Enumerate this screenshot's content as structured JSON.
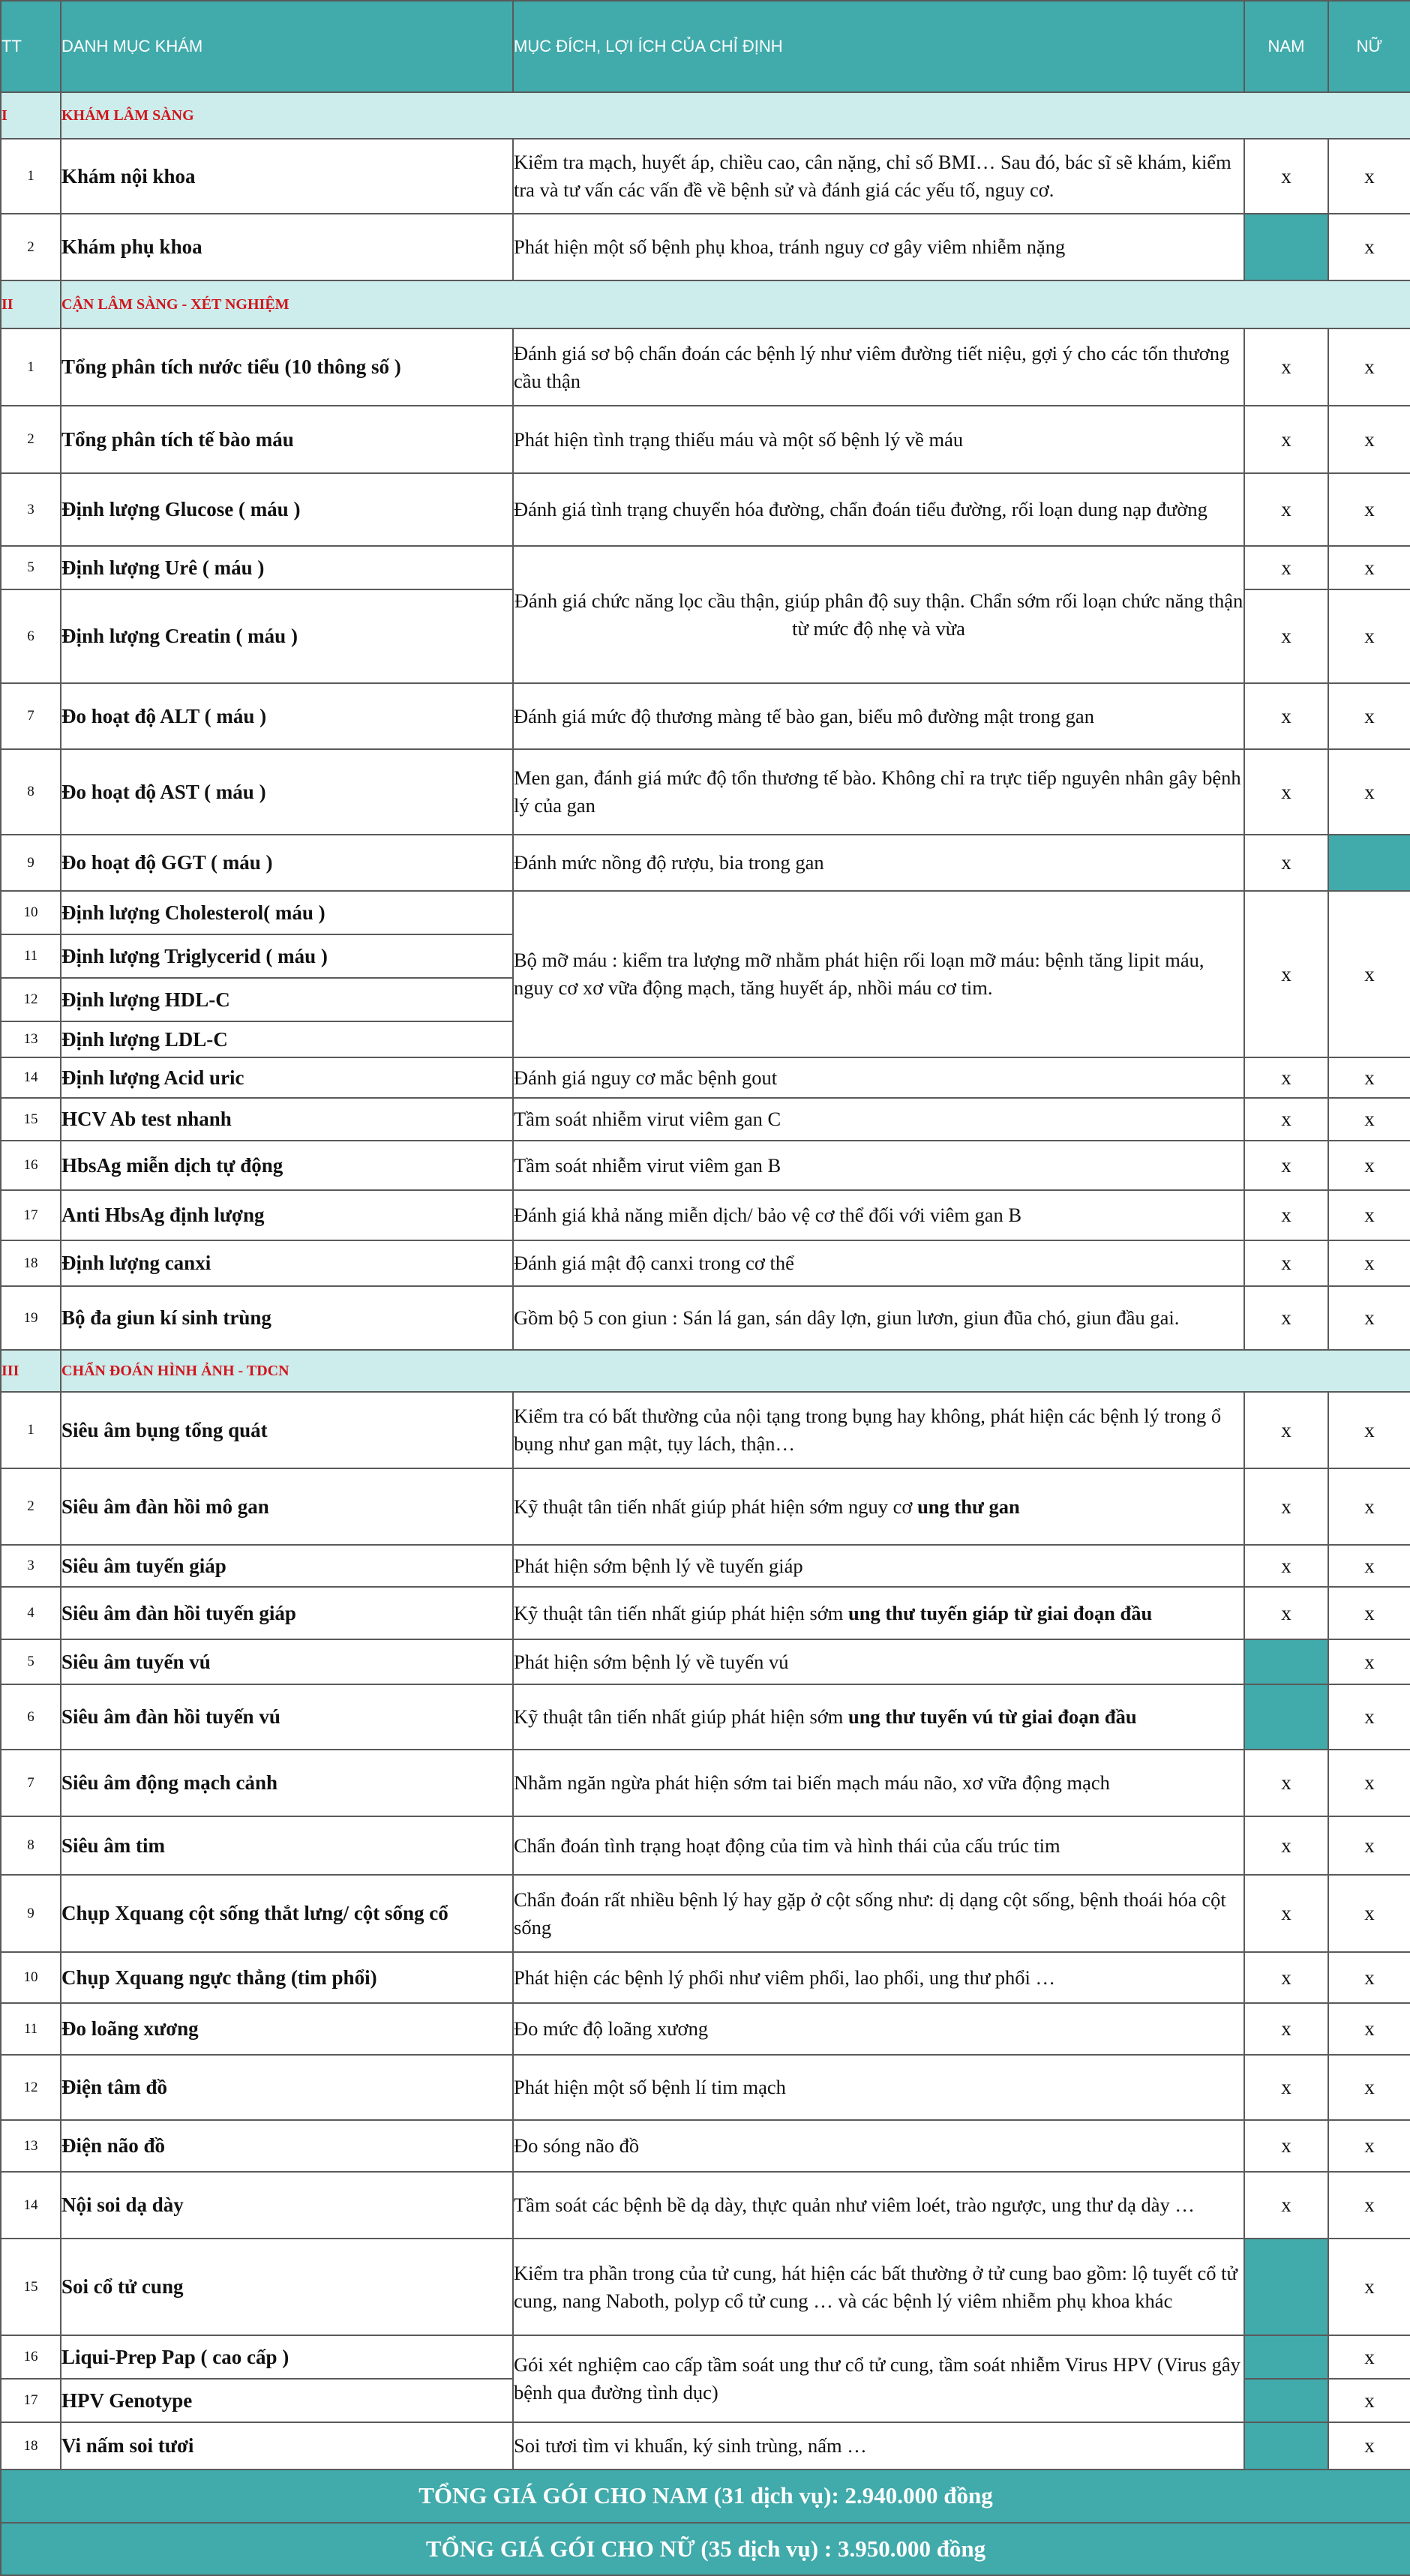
{
  "header": {
    "tt": "TT",
    "item": "DANH MỤC KHÁM",
    "purpose": "MỤC ĐÍCH, LỢI ÍCH CỦA CHỈ ĐỊNH",
    "male": "NAM",
    "female": "NỮ"
  },
  "colors": {
    "accent": "#41aaab",
    "section_bg": "#cdecec",
    "section_text": "#d0161c"
  },
  "sections": [
    {
      "roman": "I",
      "title": "KHÁM LÂM SÀNG",
      "rows": [
        {
          "no": "1",
          "name": "Khám nội khoa",
          "desc": "Kiểm tra mạch, huyết áp, chiều cao, cân nặng, chỉ số BMI… Sau đó, bác sĩ sẽ khám, kiểm tra và tư vấn các vấn đề về bệnh sử và đánh giá các yếu tố, nguy cơ.",
          "male": "x",
          "female": "x"
        },
        {
          "no": "2",
          "name": "Khám phụ khoa",
          "desc": "Phát hiện một số bệnh phụ khoa, tránh nguy cơ gây viêm nhiễm nặng",
          "male": null,
          "female": "x"
        }
      ]
    },
    {
      "roman": "II",
      "title": "CẬN LÂM SÀNG - XÉT NGHIỆM",
      "rows": [
        {
          "no": "1",
          "name": "Tổng phân tích nước tiểu (10 thông số )",
          "desc": "Đánh giá sơ bộ chẩn đoán các bệnh lý như viêm đường tiết niệu, gợi ý cho các tổn thương cầu thận",
          "male": "x",
          "female": "x"
        },
        {
          "no": "2",
          "name": "Tổng phân tích tế bào máu",
          "desc": "Phát hiện tình trạng thiếu máu và một số bệnh lý về máu",
          "male": "x",
          "female": "x"
        },
        {
          "no": "3",
          "name": "Định lượng Glucose ( máu )",
          "desc": "Đánh giá tình trạng chuyển hóa đường, chẩn đoán tiểu đường, rối loạn dung nạp đường",
          "male": "x",
          "female": "x"
        },
        {
          "no": "5",
          "name": "Định lượng Urê ( máu )",
          "desc": "Đánh giá chức năng lọc cầu thận, giúp phân độ suy thận. Chẩn sớm rối loạn chức năng thận từ mức độ nhẹ và vừa",
          "male": "x",
          "female": "x"
        },
        {
          "no": "6",
          "name": "Định lượng Creatin ( máu )",
          "male": "x",
          "female": "x"
        },
        {
          "no": "7",
          "name": "Đo hoạt độ ALT ( máu )",
          "desc": "Đánh giá mức độ thương màng tế bào gan, biểu mô đường mật trong gan",
          "male": "x",
          "female": "x"
        },
        {
          "no": "8",
          "name": "Đo hoạt độ AST ( máu )",
          "desc": "Men gan, đánh giá mức độ tổn thương tế bào. Không chỉ ra trực tiếp nguyên nhân gây bệnh lý của gan",
          "male": "x",
          "female": "x"
        },
        {
          "no": "9",
          "name": "Đo hoạt độ GGT ( máu )",
          "desc": "Đánh mức nồng độ rượu, bia trong gan",
          "male": "x",
          "female": null
        },
        {
          "no": "10",
          "name": "Định lượng Cholesterol( máu )",
          "desc": "Bộ mỡ máu : kiểm tra lượng mỡ nhằm phát hiện rối loạn mỡ máu: bệnh tăng lipit máu, nguy cơ xơ vữa động mạch, tăng huyết áp, nhồi máu cơ tim.",
          "male": "x",
          "female": "x"
        },
        {
          "no": "11",
          "name": "Định lượng Triglycerid ( máu )"
        },
        {
          "no": "12",
          "name": "Định lượng HDL-C"
        },
        {
          "no": "13",
          "name": "Định lượng LDL-C"
        },
        {
          "no": "14",
          "name": "Định lượng Acid uric",
          "desc": "Đánh giá nguy cơ mắc bệnh gout",
          "male": "x",
          "female": "x"
        },
        {
          "no": "15",
          "name": "HCV Ab test nhanh",
          "desc": "Tầm soát nhiễm virut viêm gan C",
          "male": "x",
          "female": "x"
        },
        {
          "no": "16",
          "name": "HbsAg miễn dịch tự động",
          "desc": "Tầm soát nhiễm virut viêm gan  B",
          "male": "x",
          "female": "x"
        },
        {
          "no": "17",
          "name": "Anti HbsAg định lượng",
          "desc": "Đánh giá khả năng miễn dịch/ bảo vệ cơ thể đối với viêm gan B",
          "male": "x",
          "female": "x"
        },
        {
          "no": "18",
          "name": "Định lượng canxi",
          "desc": "Đánh giá mật độ canxi trong cơ thể",
          "male": "x",
          "female": "x"
        },
        {
          "no": "19",
          "name": "Bộ đa giun kí sinh trùng",
          "desc": "Gồm bộ 5 con giun : Sán lá gan, sán dây lợn, giun lươn, giun đũa chó, giun đầu gai.",
          "male": "x",
          "female": "x"
        }
      ]
    },
    {
      "roman": "III",
      "title": "CHẨN ĐOÁN HÌNH ẢNH - TDCN",
      "rows": [
        {
          "no": "1",
          "name": "Siêu âm bụng tổng quát",
          "desc": "Kiểm tra có bất thường của nội tạng trong bụng hay không, phát hiện các bệnh lý trong ổ bụng như gan mật, tụy lách, thận…",
          "male": "x",
          "female": "x"
        },
        {
          "no": "2",
          "name": "Siêu âm đàn hồi mô gan",
          "desc": "Kỹ thuật tân tiến nhất giúp phát hiện sớm nguy cơ ",
          "desc_bold": "ung thư gan",
          "male": "x",
          "female": "x"
        },
        {
          "no": "3",
          "name": "Siêu âm tuyến giáp",
          "desc": "Phát hiện sớm bệnh lý về tuyến giáp",
          "male": "x",
          "female": "x"
        },
        {
          "no": "4",
          "name": "Siêu âm đàn hồi tuyến giáp",
          "desc": "Kỹ thuật tân tiến nhất giúp phát hiện sớm ",
          "desc_bold": "ung thư tuyến giáp từ giai đoạn đầu",
          "male": "x",
          "female": "x"
        },
        {
          "no": "5",
          "name": "Siêu âm tuyến vú",
          "desc": "Phát hiện sớm bệnh lý về tuyến vú",
          "male": null,
          "female": "x"
        },
        {
          "no": "6",
          "name": "Siêu âm đàn hồi tuyến vú",
          "desc": "Kỹ thuật tân tiến nhất giúp phát hiện sớm ",
          "desc_bold": "ung thư tuyến vú từ giai đoạn đầu",
          "male": null,
          "female": "x"
        },
        {
          "no": "7",
          "name": "Siêu âm động mạch cảnh",
          "desc": "Nhằm ngăn ngừa phát hiện sớm tai biến mạch máu não, xơ vữa động mạch",
          "male": "x",
          "female": "x"
        },
        {
          "no": "8",
          "name": "Siêu âm tim",
          "desc": "Chẩn đoán tình trạng hoạt động của tim và hình thái của cấu trúc tim",
          "male": "x",
          "female": "x"
        },
        {
          "no": "9",
          "name": "Chụp Xquang cột sống thắt lưng/ cột sống cổ",
          "desc": "Chẩn đoán rất nhiều bệnh lý hay gặp ở cột sống như: dị dạng cột sống, bệnh thoái hóa cột sống",
          "male": "x",
          "female": "x"
        },
        {
          "no": "10",
          "name": "Chụp Xquang ngực thẳng (tim phổi)",
          "desc": "Phát hiện các bệnh lý phổi như viêm phổi, lao phổi, ung thư phổi …",
          "male": "x",
          "female": "x"
        },
        {
          "no": "11",
          "name": "Đo loãng xương",
          "desc": "Đo mức độ loãng xương",
          "male": "x",
          "female": "x"
        },
        {
          "no": "12",
          "name": "Điện tâm đồ",
          "desc": "Phát hiện một số bệnh lí tim mạch",
          "male": "x",
          "female": "x"
        },
        {
          "no": "13",
          "name": "Điện não đồ",
          "desc": "Đo sóng não đồ",
          "male": "x",
          "female": "x"
        },
        {
          "no": "14",
          "name": "Nội soi dạ dày",
          "desc": "Tầm soát các bệnh bề dạ dày, thực quản như viêm loét, trào ngược, ung thư dạ dày …",
          "male": "x",
          "female": "x"
        },
        {
          "no": "15",
          "name": "Soi cổ tử cung",
          "desc": "Kiểm tra phần trong của tử cung, hát hiện các bất thường ở tử cung bao gồm: lộ tuyết cổ tử cung, nang Naboth, polyp cổ tử cung … và các bệnh lý viêm nhiễm phụ khoa khác",
          "male": null,
          "female": "x"
        },
        {
          "no": "16",
          "name": "Liqui-Prep Pap ( cao cấp )",
          "desc": "Gói xét nghiệm cao cấp tầm soát ung thư cổ tử cung, tầm soát nhiễm Virus HPV (Virus gây bệnh qua đường tình dục)",
          "male": null,
          "female": "x"
        },
        {
          "no": "17",
          "name": "HPV Genotype",
          "male": null,
          "female": "x"
        },
        {
          "no": "18",
          "name": "Vi nấm soi tươi",
          "desc": "Soi tươi tìm vi khuẩn, ký sinh trùng, nấm …",
          "male": null,
          "female": "x"
        }
      ]
    }
  ],
  "totals": {
    "male": "TỔNG GIÁ GÓI CHO NAM (31 dịch vụ): 2.940.000 đồng",
    "female": "TỔNG GIÁ GÓI CHO NỮ (35 dịch vụ) : 3.950.000 đồng"
  }
}
